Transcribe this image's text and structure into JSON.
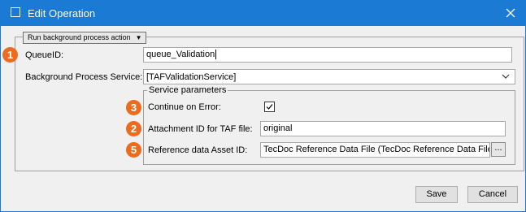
{
  "window": {
    "title": "Edit Operation",
    "accent_color": "#1a7ad4",
    "badge_color": "#ec6b1f"
  },
  "group": {
    "dropdown_label": "Run background process action"
  },
  "fields": {
    "queue_id_label": "QueueID:",
    "queue_id_value": "queue_Validation",
    "bg_service_label": "Background Process Service:",
    "bg_service_value": "[TAFValidationService]"
  },
  "service_parameters": {
    "title": "Service parameters",
    "continue_on_error_label": "Continue on Error:",
    "continue_on_error_checked": true,
    "attachment_label": "Attachment ID for TAF file:",
    "attachment_value": "original",
    "reference_label": "Reference data Asset ID:",
    "reference_value": "TecDoc Reference Data File (TecDoc Reference Data File)",
    "browse_label": "..."
  },
  "badges": {
    "queue_id": "1",
    "attachment": "2",
    "continue_on_error": "3",
    "reference": "5"
  },
  "buttons": {
    "save": "Save",
    "cancel": "Cancel"
  },
  "icons": {
    "close": "close-icon",
    "window": "window-icon",
    "chevron": "chevron-down-icon",
    "checkmark": "checkmark-icon"
  }
}
